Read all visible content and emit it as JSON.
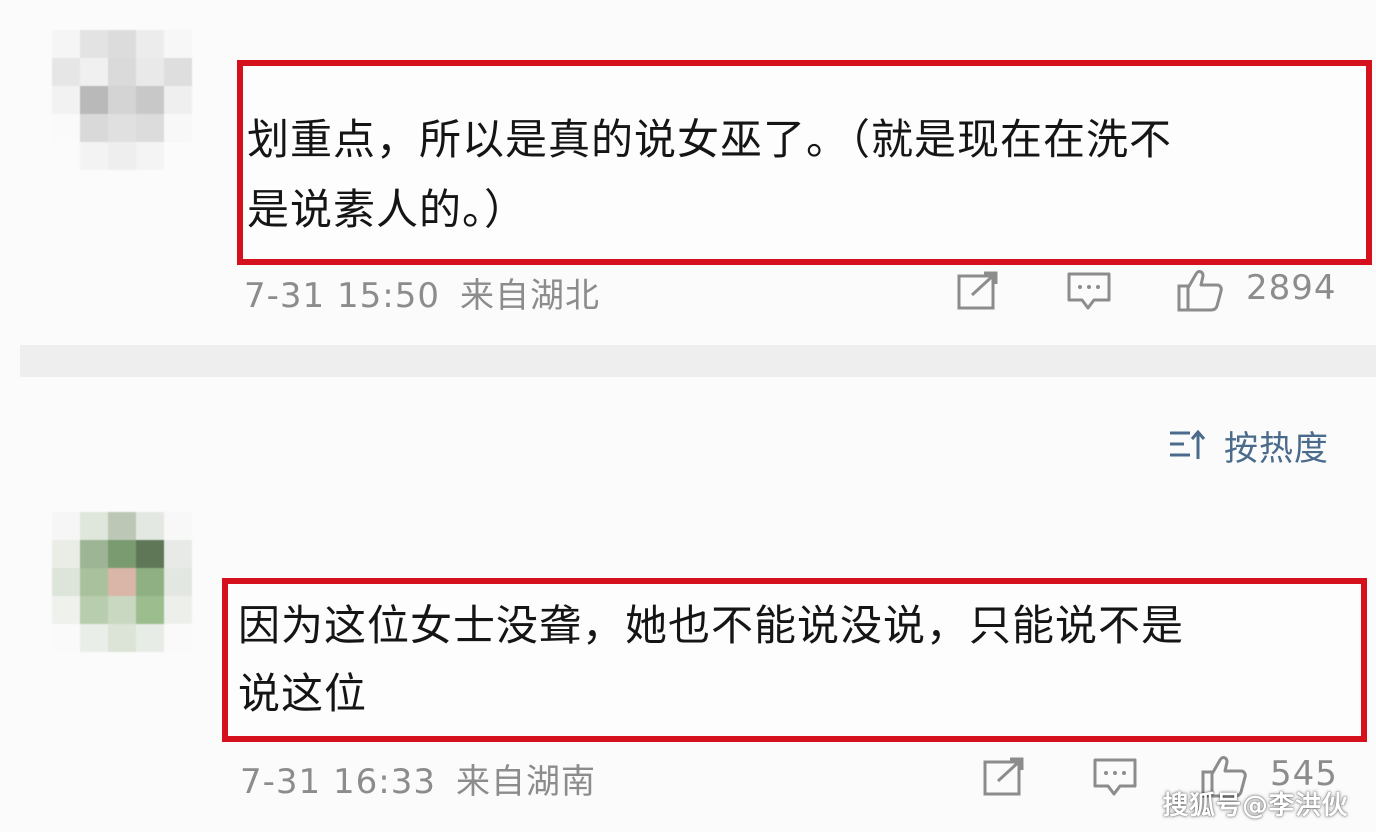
{
  "comments": [
    {
      "text": "划重点，所以是真的说女巫了。（就是现在在洗不是说素人的。）",
      "line1": "划重点，所以是真的说女巫了。（就是现在在洗不",
      "line2": "是说素人的。）",
      "time": "7-31 15:50",
      "location": "来自湖北",
      "likes": "2894",
      "avatar_icon": "pixelated-avatar"
    },
    {
      "text": "因为这位女士没聋，她也不能说没说，只能说不是说这位",
      "line1": "因为这位女士没聋，她也不能说没说，只能说不是",
      "line2": "说这位",
      "time": "7-31 16:33",
      "location": "来自湖南",
      "likes": "545",
      "avatar_icon": "pixelated-avatar"
    }
  ],
  "sort": {
    "label": "按热度",
    "icon": "sort-icon"
  },
  "watermark": "搜狐号@李洪伙",
  "colors": {
    "highlight_border": "#d6111e",
    "meta_text": "#8c8c8c",
    "sort_text": "#4a6b8c",
    "divider": "#eeeeee"
  }
}
